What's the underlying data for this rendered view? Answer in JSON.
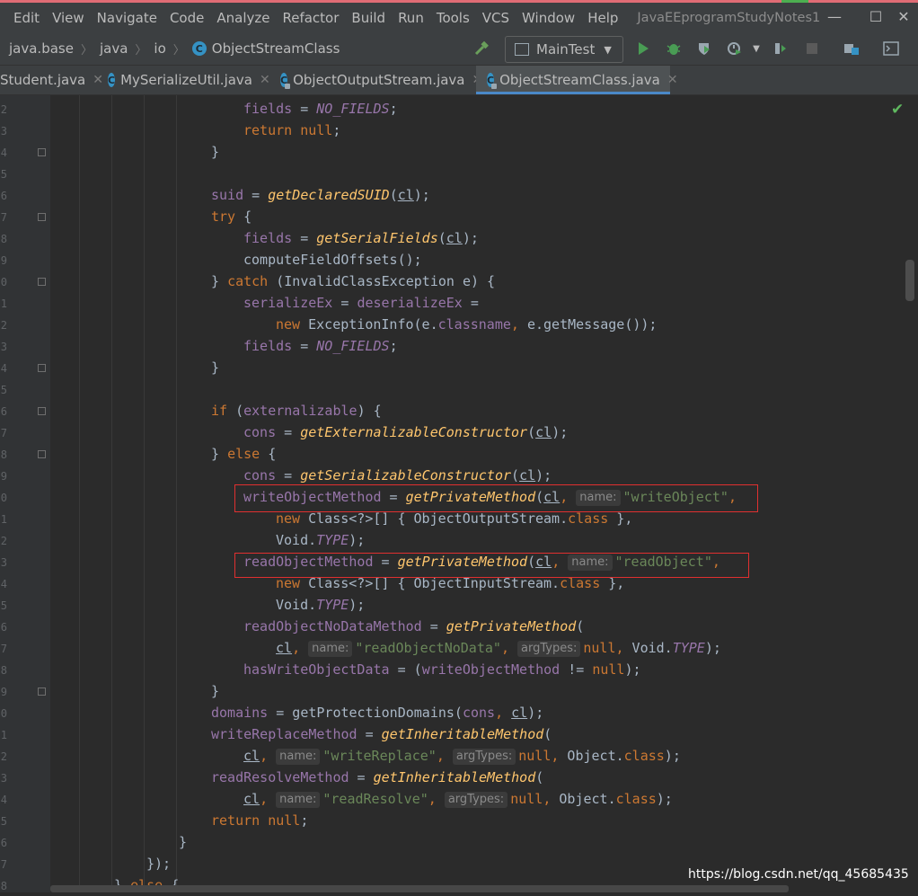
{
  "menu": {
    "items": [
      "Edit",
      "View",
      "Navigate",
      "Code",
      "Analyze",
      "Refactor",
      "Build",
      "Run",
      "Tools",
      "VCS",
      "Window",
      "Help"
    ],
    "project_title": "JavaEEprogramStudyNotes1"
  },
  "window_controls": {
    "minimize": "—",
    "maximize": "☐",
    "close": "✕"
  },
  "breadcrumb": {
    "module": "java.base",
    "package1": "java",
    "package2": "io",
    "class": "ObjectStreamClass"
  },
  "toolbar": {
    "run_config": "MainTest"
  },
  "tabs": [
    {
      "label": "Student.java",
      "close": "✕"
    },
    {
      "label": "MySerializeUtil.java",
      "close": "✕"
    },
    {
      "label": "ObjectOutputStream.java",
      "close": "✕"
    },
    {
      "label": "ObjectStreamClass.java",
      "close": "✕",
      "active": true
    }
  ],
  "gutter": {
    "line_digits": [
      "2",
      "3",
      "4",
      "5",
      "6",
      "7",
      "8",
      "9",
      "0",
      "1",
      "2",
      "3",
      "4",
      "5",
      "6",
      "7",
      "8",
      "9",
      "0",
      "1",
      "2",
      "3",
      "4",
      "5",
      "6",
      "7",
      "8",
      "9",
      "0",
      "1",
      "2",
      "3",
      "4",
      "5",
      "6",
      "7",
      "8"
    ]
  },
  "code_lines": [
    [
      [
        "fld",
        "fields"
      ],
      [
        "plain",
        " = "
      ],
      [
        "cst",
        "NO_FIELDS"
      ],
      [
        "plain",
        ";"
      ]
    ],
    [
      [
        "kw",
        "return null"
      ],
      [
        "plain",
        ";"
      ]
    ],
    [
      [
        "plain",
        "}"
      ]
    ],
    [],
    [
      [
        "fld",
        "suid"
      ],
      [
        "plain",
        " = "
      ],
      [
        "smeth",
        "getDeclaredSUID"
      ],
      [
        "plain",
        "("
      ],
      [
        "param",
        "cl"
      ],
      [
        "plain",
        ");"
      ]
    ],
    [
      [
        "kw",
        "try "
      ],
      [
        "plain",
        "{"
      ]
    ],
    [
      [
        "fld",
        "fields"
      ],
      [
        "plain",
        " = "
      ],
      [
        "smeth",
        "getSerialFields"
      ],
      [
        "plain",
        "("
      ],
      [
        "param",
        "cl"
      ],
      [
        "plain",
        ");"
      ]
    ],
    [
      [
        "plain",
        "computeFieldOffsets();"
      ]
    ],
    [
      [
        "plain",
        "} "
      ],
      [
        "kw",
        "catch "
      ],
      [
        "plain",
        "(InvalidClassException e) {"
      ]
    ],
    [
      [
        "fld",
        "serializeEx"
      ],
      [
        "plain",
        " = "
      ],
      [
        "fld",
        "deserializeEx"
      ],
      [
        "plain",
        " ="
      ]
    ],
    [
      [
        "kw",
        "new "
      ],
      [
        "plain",
        "ExceptionInfo(e."
      ],
      [
        "fld",
        "classname"
      ],
      [
        "kw",
        ", "
      ],
      [
        "plain",
        "e.getMessage());"
      ]
    ],
    [
      [
        "fld",
        "fields"
      ],
      [
        "plain",
        " = "
      ],
      [
        "cst",
        "NO_FIELDS"
      ],
      [
        "plain",
        ";"
      ]
    ],
    [
      [
        "plain",
        "}"
      ]
    ],
    [],
    [
      [
        "kw",
        "if "
      ],
      [
        "plain",
        "("
      ],
      [
        "fld",
        "externalizable"
      ],
      [
        "plain",
        ") {"
      ]
    ],
    [
      [
        "fld",
        "cons"
      ],
      [
        "plain",
        " = "
      ],
      [
        "smeth",
        "getExternalizableConstructor"
      ],
      [
        "plain",
        "("
      ],
      [
        "param",
        "cl"
      ],
      [
        "plain",
        ");"
      ]
    ],
    [
      [
        "plain",
        "} "
      ],
      [
        "kw",
        "else "
      ],
      [
        "plain",
        "{"
      ]
    ],
    [
      [
        "fld",
        "cons"
      ],
      [
        "plain",
        " = "
      ],
      [
        "smeth",
        "getSerializableConstructor"
      ],
      [
        "plain",
        "("
      ],
      [
        "param",
        "cl"
      ],
      [
        "plain",
        ");"
      ]
    ],
    [
      [
        "fld",
        "writeObjectMethod"
      ],
      [
        "plain",
        " = "
      ],
      [
        "smeth",
        "getPrivateMethod"
      ],
      [
        "plain",
        "("
      ],
      [
        "param",
        "cl"
      ],
      [
        "kw",
        ", "
      ],
      [
        "hint",
        "name:"
      ],
      [
        "str",
        "\"writeObject\""
      ],
      [
        "kw",
        ","
      ]
    ],
    [
      [
        "kw",
        "new "
      ],
      [
        "plain",
        "Class<?>[] { ObjectOutputStream."
      ],
      [
        "kw",
        "class "
      ],
      [
        "plain",
        "},"
      ]
    ],
    [
      [
        "plain",
        "Void."
      ],
      [
        "cst",
        "TYPE"
      ],
      [
        "plain",
        ");"
      ]
    ],
    [
      [
        "fld",
        "readObjectMethod"
      ],
      [
        "plain",
        " = "
      ],
      [
        "smeth",
        "getPrivateMethod"
      ],
      [
        "plain",
        "("
      ],
      [
        "param",
        "cl"
      ],
      [
        "kw",
        ", "
      ],
      [
        "hint",
        "name:"
      ],
      [
        "str",
        "\"readObject\""
      ],
      [
        "kw",
        ","
      ]
    ],
    [
      [
        "kw",
        "new "
      ],
      [
        "plain",
        "Class<?>[] { ObjectInputStream."
      ],
      [
        "kw",
        "class "
      ],
      [
        "plain",
        "},"
      ]
    ],
    [
      [
        "plain",
        "Void."
      ],
      [
        "cst",
        "TYPE"
      ],
      [
        "plain",
        ");"
      ]
    ],
    [
      [
        "fld",
        "readObjectNoDataMethod"
      ],
      [
        "plain",
        " = "
      ],
      [
        "smeth",
        "getPrivateMethod"
      ],
      [
        "plain",
        "("
      ]
    ],
    [
      [
        "param",
        "cl"
      ],
      [
        "kw",
        ", "
      ],
      [
        "hint",
        "name:"
      ],
      [
        "str",
        "\"readObjectNoData\""
      ],
      [
        "kw",
        ", "
      ],
      [
        "hint",
        "argTypes:"
      ],
      [
        "kw",
        "null"
      ],
      [
        "kw",
        ", "
      ],
      [
        "plain",
        "Void."
      ],
      [
        "cst",
        "TYPE"
      ],
      [
        "plain",
        ");"
      ]
    ],
    [
      [
        "fld",
        "hasWriteObjectData"
      ],
      [
        "plain",
        " = ("
      ],
      [
        "fld",
        "writeObjectMethod"
      ],
      [
        "plain",
        " != "
      ],
      [
        "kw",
        "null"
      ],
      [
        "plain",
        ");"
      ]
    ],
    [
      [
        "plain",
        "}"
      ]
    ],
    [
      [
        "fld",
        "domains"
      ],
      [
        "plain",
        " = getProtectionDomains("
      ],
      [
        "fld",
        "cons"
      ],
      [
        "kw",
        ", "
      ],
      [
        "param",
        "cl"
      ],
      [
        "plain",
        ");"
      ]
    ],
    [
      [
        "fld",
        "writeReplaceMethod"
      ],
      [
        "plain",
        " = "
      ],
      [
        "smeth",
        "getInheritableMethod"
      ],
      [
        "plain",
        "("
      ]
    ],
    [
      [
        "param",
        "cl"
      ],
      [
        "kw",
        ", "
      ],
      [
        "hint",
        "name:"
      ],
      [
        "str",
        "\"writeReplace\""
      ],
      [
        "kw",
        ", "
      ],
      [
        "hint",
        "argTypes:"
      ],
      [
        "kw",
        "null"
      ],
      [
        "kw",
        ", "
      ],
      [
        "plain",
        "Object."
      ],
      [
        "kw",
        "class"
      ],
      [
        "plain",
        ");"
      ]
    ],
    [
      [
        "fld",
        "readResolveMethod"
      ],
      [
        "plain",
        " = "
      ],
      [
        "smeth",
        "getInheritableMethod"
      ],
      [
        "plain",
        "("
      ]
    ],
    [
      [
        "param",
        "cl"
      ],
      [
        "kw",
        ", "
      ],
      [
        "hint",
        "name:"
      ],
      [
        "str",
        "\"readResolve\""
      ],
      [
        "kw",
        ", "
      ],
      [
        "hint",
        "argTypes:"
      ],
      [
        "kw",
        "null"
      ],
      [
        "kw",
        ", "
      ],
      [
        "plain",
        "Object."
      ],
      [
        "kw",
        "class"
      ],
      [
        "plain",
        ");"
      ]
    ],
    [
      [
        "kw",
        "return null"
      ],
      [
        "plain",
        ";"
      ]
    ],
    [
      [
        "plain",
        "}"
      ]
    ],
    [
      [
        "plain",
        "});"
      ]
    ],
    [
      [
        "plain",
        "} "
      ],
      [
        "kw",
        "else "
      ],
      [
        "plain",
        "{"
      ]
    ]
  ],
  "watermark": "https://blog.csdn.net/qq_45685435",
  "colors": {
    "editor_bg": "#2b2b2b",
    "keyword": "#cc7832",
    "field": "#9876aa",
    "method_decl": "#ffc66d",
    "string": "#6a8759",
    "plain": "#a9b7c6",
    "highlight_box": "#e03030",
    "tab_active_underline": "#4a88c7"
  },
  "icons": [
    "hammer-icon",
    "run-icon",
    "debug-icon",
    "coverage-icon",
    "profile-icon",
    "stop-icon",
    "project-structure-icon",
    "terminal-icon",
    "check-icon",
    "class-icon"
  ]
}
